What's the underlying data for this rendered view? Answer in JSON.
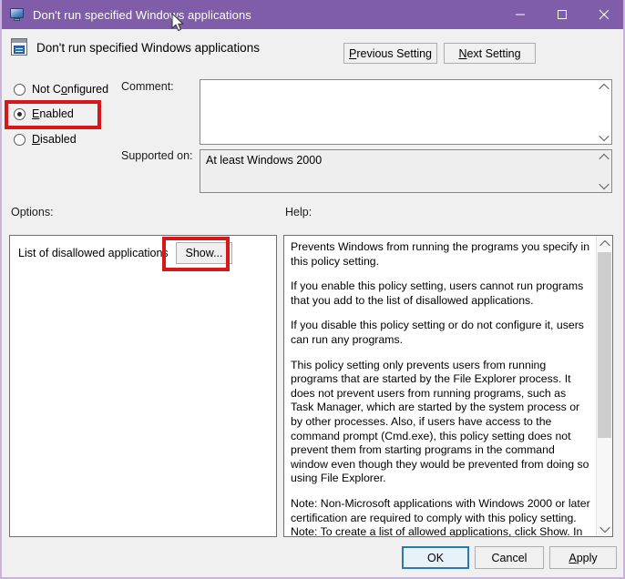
{
  "window": {
    "title": "Don't run specified Windows applications",
    "title_icon": "monitor-icon",
    "minimize_label": "—",
    "maximize_label": "□",
    "close_label": "✕",
    "accent_color": "#7f5da8",
    "border_color": "#c9b3dd"
  },
  "header": {
    "policy_icon": "policy-document-icon",
    "title": "Don't run specified Windows applications",
    "previous_setting": {
      "accel": "P",
      "rest": "revious Setting"
    },
    "next_setting": {
      "accel": "N",
      "rest": "ext Setting"
    }
  },
  "state": {
    "radios": [
      {
        "id": "not-configured",
        "accel_pre": "Not C",
        "accel": "o",
        "accel_post": "nfigured",
        "checked": false
      },
      {
        "id": "enabled",
        "accel_pre": "",
        "accel": "E",
        "accel_post": "nabled",
        "checked": true
      },
      {
        "id": "disabled",
        "accel_pre": "",
        "accel": "D",
        "accel_post": "isabled",
        "checked": false
      }
    ],
    "selected": "enabled"
  },
  "fields": {
    "comment_label": "Comment:",
    "comment_value": "",
    "supported_label": "Supported on:",
    "supported_value": "At least Windows 2000"
  },
  "sections": {
    "options_label": "Options:",
    "help_label": "Help:"
  },
  "options": {
    "item_label": "List of disallowed applications",
    "show_button": "Show..."
  },
  "help": {
    "paragraphs": [
      "Prevents Windows from running the programs you specify in this policy setting.",
      "If you enable this policy setting, users cannot run programs that you add to the list of disallowed applications.",
      "If you disable this policy setting or do not configure it, users can run any programs.",
      "This policy setting only prevents users from running programs that are started by the File Explorer process. It does not prevent users from running programs, such as Task Manager, which are started by the system process or by other processes.  Also, if users have access to the command prompt (Cmd.exe), this policy setting does not prevent them from starting programs in the command window even though they would be prevented from doing so using File Explorer.",
      "Note: Non-Microsoft applications with Windows 2000 or later certification are required to comply with this policy setting.",
      "Note: To create a list of allowed applications, click Show.  In the"
    ]
  },
  "footer": {
    "ok": "OK",
    "cancel": "Cancel",
    "apply_accel": "A",
    "apply_rest": "pply"
  },
  "annotations": {
    "highlight_color": "#d5191b",
    "targets": [
      "enabled-radio",
      "show-button"
    ]
  }
}
